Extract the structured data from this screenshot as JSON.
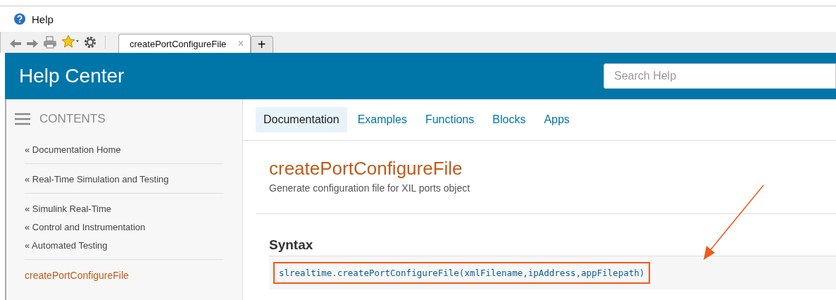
{
  "window": {
    "title": "Help"
  },
  "browser_tabs": [
    {
      "label": "createPortConfigureFile",
      "selected": true,
      "close": "×"
    }
  ],
  "new_tab": "+",
  "header": {
    "title": "Help Center",
    "search": {
      "placeholder": "Search Help"
    }
  },
  "sidebar": {
    "heading": "CONTENTS",
    "groups": [
      [
        {
          "label": "« Documentation Home",
          "kind": "parent"
        }
      ],
      [
        {
          "label": "« Real-Time Simulation and Testing",
          "kind": "parent"
        }
      ],
      [
        {
          "label": "« Simulink Real-Time",
          "kind": "parent"
        },
        {
          "label": "« Control and Instrumentation",
          "kind": "parent"
        },
        {
          "label": "« Automated Testing",
          "kind": "parent"
        }
      ],
      [
        {
          "label": "createPortConfigureFile",
          "kind": "current"
        }
      ]
    ]
  },
  "content_tabs": [
    {
      "label": "Documentation",
      "selected": true
    },
    {
      "label": "Examples",
      "selected": false
    },
    {
      "label": "Functions",
      "selected": false
    },
    {
      "label": "Blocks",
      "selected": false
    },
    {
      "label": "Apps",
      "selected": false
    }
  ],
  "page": {
    "title": "createPortConfigureFile",
    "subtitle": "Generate configuration file for XIL ports object",
    "section": "Syntax",
    "syntax": "slrealtime.createPortConfigureFile(xmlFilename,ipAddress,appFilepath)",
    "highlighted": true
  }
}
